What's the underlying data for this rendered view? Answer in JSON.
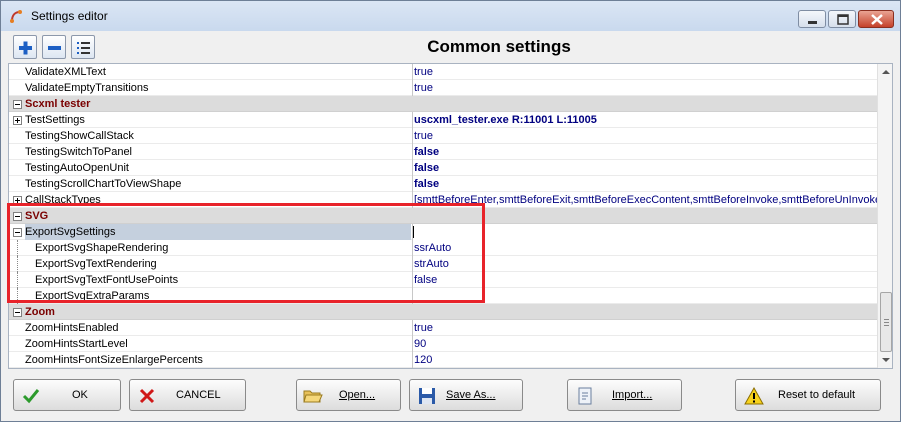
{
  "window": {
    "title": "Settings editor"
  },
  "toolbar": {
    "heading": "Common settings"
  },
  "rows": [
    {
      "kind": "prop",
      "name": "ValidateXMLText",
      "value": "true",
      "bold": false
    },
    {
      "kind": "prop",
      "name": "ValidateEmptyTransitions",
      "value": "true",
      "bold": false
    },
    {
      "kind": "cat",
      "name": "Scxml tester"
    },
    {
      "kind": "prop",
      "name": "TestSettings",
      "value": "uscxml_tester.exe R:11001 L:11005",
      "bold": true,
      "expandable": true
    },
    {
      "kind": "prop",
      "name": "TestingShowCallStack",
      "value": "true",
      "bold": false
    },
    {
      "kind": "prop",
      "name": "TestingSwitchToPanel",
      "value": "false",
      "bold": true
    },
    {
      "kind": "prop",
      "name": "TestingAutoOpenUnit",
      "value": "false",
      "bold": true
    },
    {
      "kind": "prop",
      "name": "TestingScrollChartToViewShape",
      "value": "false",
      "bold": true
    },
    {
      "kind": "prop",
      "name": "CallStackTypes",
      "value": "[smttBeforeEnter,smttBeforeExit,smttBeforeExecContent,smttBeforeInvoke,smttBeforeUnInvoke",
      "bold": false,
      "expandable": true
    },
    {
      "kind": "cat",
      "name": "SVG"
    },
    {
      "kind": "prop",
      "name": "ExportSvgSettings",
      "value": "",
      "bold": false,
      "expanded": true,
      "selected": true
    },
    {
      "kind": "sub",
      "name": "ExportSvgShapeRendering",
      "value": "ssrAuto",
      "bold": false
    },
    {
      "kind": "sub",
      "name": "ExportSvgTextRendering",
      "value": "strAuto",
      "bold": false
    },
    {
      "kind": "sub",
      "name": "ExportSvgTextFontUsePoints",
      "value": "false",
      "bold": false
    },
    {
      "kind": "sub",
      "name": "ExportSvgExtraParams",
      "value": "",
      "bold": false
    },
    {
      "kind": "cat",
      "name": "Zoom"
    },
    {
      "kind": "prop",
      "name": "ZoomHintsEnabled",
      "value": "true",
      "bold": false
    },
    {
      "kind": "prop",
      "name": "ZoomHintsStartLevel",
      "value": "90",
      "bold": false
    },
    {
      "kind": "prop",
      "name": "ZoomHintsFontSizeEnlargePercents",
      "value": "120",
      "bold": false
    }
  ],
  "buttons": {
    "ok": "OK",
    "cancel": "CANCEL",
    "open": "Open...",
    "save_as": "Save As...",
    "import": "Import...",
    "reset": "Reset to default"
  },
  "colors": {
    "highlight": "#e8232a",
    "category_text": "#7a0000",
    "value_text": "#000080"
  },
  "icons": {
    "expand_all": "plus-icon",
    "collapse_all": "minus-icon",
    "list_view": "list-icon",
    "ok": "checkmark-icon",
    "cancel": "x-icon",
    "open": "folder-open-icon",
    "save_as": "floppy-disk-icon",
    "import": "import-document-icon",
    "reset": "warning-icon"
  }
}
